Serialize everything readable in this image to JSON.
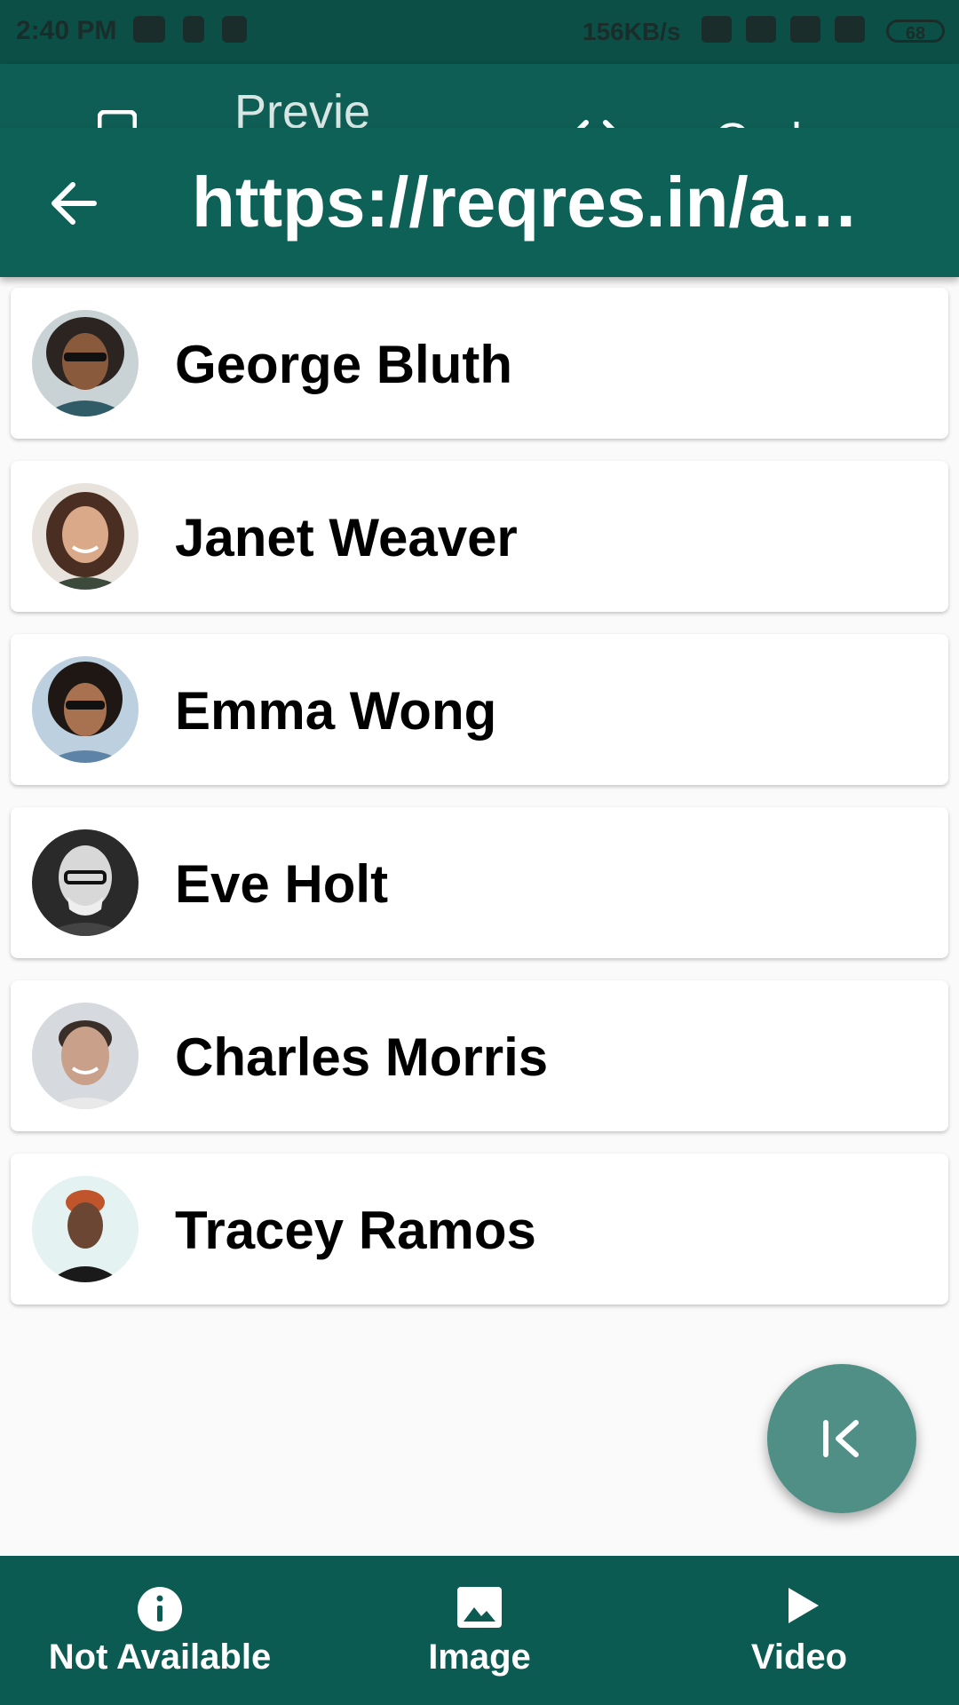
{
  "status_bar": {
    "time": "2:40 PM",
    "speed": "156KB/s",
    "battery": "68"
  },
  "tabs": {
    "preview_label": "Preview",
    "code_label": "Code"
  },
  "app_bar": {
    "title": "https://reqres.in/api..."
  },
  "users": [
    {
      "name": "George Bluth"
    },
    {
      "name": "Janet Weaver"
    },
    {
      "name": "Emma Wong"
    },
    {
      "name": "Eve Holt"
    },
    {
      "name": "Charles Morris"
    },
    {
      "name": "Tracey Ramos"
    }
  ],
  "bottom_nav": {
    "items": [
      {
        "label": "Not Available",
        "icon": "info-icon"
      },
      {
        "label": "Image",
        "icon": "image-icon"
      },
      {
        "label": "Video",
        "icon": "play-icon"
      }
    ]
  },
  "colors": {
    "primary": "#0d6157",
    "status_bar": "#0b4f47",
    "fab": "#4f8f86",
    "background": "#fafafa"
  }
}
